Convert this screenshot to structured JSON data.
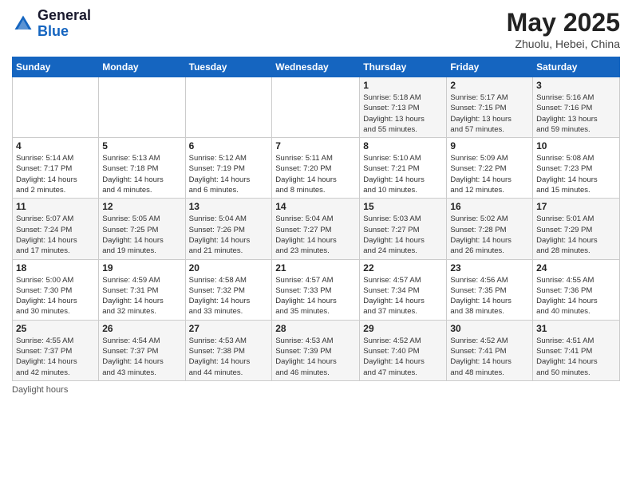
{
  "logo": {
    "general": "General",
    "blue": "Blue"
  },
  "title": {
    "month": "May 2025",
    "location": "Zhuolu, Hebei, China"
  },
  "days_of_week": [
    "Sunday",
    "Monday",
    "Tuesday",
    "Wednesday",
    "Thursday",
    "Friday",
    "Saturday"
  ],
  "footer": {
    "daylight_hours": "Daylight hours"
  },
  "weeks": [
    [
      {
        "day": "",
        "info": ""
      },
      {
        "day": "",
        "info": ""
      },
      {
        "day": "",
        "info": ""
      },
      {
        "day": "",
        "info": ""
      },
      {
        "day": "1",
        "info": "Sunrise: 5:18 AM\nSunset: 7:13 PM\nDaylight: 13 hours\nand 55 minutes."
      },
      {
        "day": "2",
        "info": "Sunrise: 5:17 AM\nSunset: 7:15 PM\nDaylight: 13 hours\nand 57 minutes."
      },
      {
        "day": "3",
        "info": "Sunrise: 5:16 AM\nSunset: 7:16 PM\nDaylight: 13 hours\nand 59 minutes."
      }
    ],
    [
      {
        "day": "4",
        "info": "Sunrise: 5:14 AM\nSunset: 7:17 PM\nDaylight: 14 hours\nand 2 minutes."
      },
      {
        "day": "5",
        "info": "Sunrise: 5:13 AM\nSunset: 7:18 PM\nDaylight: 14 hours\nand 4 minutes."
      },
      {
        "day": "6",
        "info": "Sunrise: 5:12 AM\nSunset: 7:19 PM\nDaylight: 14 hours\nand 6 minutes."
      },
      {
        "day": "7",
        "info": "Sunrise: 5:11 AM\nSunset: 7:20 PM\nDaylight: 14 hours\nand 8 minutes."
      },
      {
        "day": "8",
        "info": "Sunrise: 5:10 AM\nSunset: 7:21 PM\nDaylight: 14 hours\nand 10 minutes."
      },
      {
        "day": "9",
        "info": "Sunrise: 5:09 AM\nSunset: 7:22 PM\nDaylight: 14 hours\nand 12 minutes."
      },
      {
        "day": "10",
        "info": "Sunrise: 5:08 AM\nSunset: 7:23 PM\nDaylight: 14 hours\nand 15 minutes."
      }
    ],
    [
      {
        "day": "11",
        "info": "Sunrise: 5:07 AM\nSunset: 7:24 PM\nDaylight: 14 hours\nand 17 minutes."
      },
      {
        "day": "12",
        "info": "Sunrise: 5:05 AM\nSunset: 7:25 PM\nDaylight: 14 hours\nand 19 minutes."
      },
      {
        "day": "13",
        "info": "Sunrise: 5:04 AM\nSunset: 7:26 PM\nDaylight: 14 hours\nand 21 minutes."
      },
      {
        "day": "14",
        "info": "Sunrise: 5:04 AM\nSunset: 7:27 PM\nDaylight: 14 hours\nand 23 minutes."
      },
      {
        "day": "15",
        "info": "Sunrise: 5:03 AM\nSunset: 7:27 PM\nDaylight: 14 hours\nand 24 minutes."
      },
      {
        "day": "16",
        "info": "Sunrise: 5:02 AM\nSunset: 7:28 PM\nDaylight: 14 hours\nand 26 minutes."
      },
      {
        "day": "17",
        "info": "Sunrise: 5:01 AM\nSunset: 7:29 PM\nDaylight: 14 hours\nand 28 minutes."
      }
    ],
    [
      {
        "day": "18",
        "info": "Sunrise: 5:00 AM\nSunset: 7:30 PM\nDaylight: 14 hours\nand 30 minutes."
      },
      {
        "day": "19",
        "info": "Sunrise: 4:59 AM\nSunset: 7:31 PM\nDaylight: 14 hours\nand 32 minutes."
      },
      {
        "day": "20",
        "info": "Sunrise: 4:58 AM\nSunset: 7:32 PM\nDaylight: 14 hours\nand 33 minutes."
      },
      {
        "day": "21",
        "info": "Sunrise: 4:57 AM\nSunset: 7:33 PM\nDaylight: 14 hours\nand 35 minutes."
      },
      {
        "day": "22",
        "info": "Sunrise: 4:57 AM\nSunset: 7:34 PM\nDaylight: 14 hours\nand 37 minutes."
      },
      {
        "day": "23",
        "info": "Sunrise: 4:56 AM\nSunset: 7:35 PM\nDaylight: 14 hours\nand 38 minutes."
      },
      {
        "day": "24",
        "info": "Sunrise: 4:55 AM\nSunset: 7:36 PM\nDaylight: 14 hours\nand 40 minutes."
      }
    ],
    [
      {
        "day": "25",
        "info": "Sunrise: 4:55 AM\nSunset: 7:37 PM\nDaylight: 14 hours\nand 42 minutes."
      },
      {
        "day": "26",
        "info": "Sunrise: 4:54 AM\nSunset: 7:37 PM\nDaylight: 14 hours\nand 43 minutes."
      },
      {
        "day": "27",
        "info": "Sunrise: 4:53 AM\nSunset: 7:38 PM\nDaylight: 14 hours\nand 44 minutes."
      },
      {
        "day": "28",
        "info": "Sunrise: 4:53 AM\nSunset: 7:39 PM\nDaylight: 14 hours\nand 46 minutes."
      },
      {
        "day": "29",
        "info": "Sunrise: 4:52 AM\nSunset: 7:40 PM\nDaylight: 14 hours\nand 47 minutes."
      },
      {
        "day": "30",
        "info": "Sunrise: 4:52 AM\nSunset: 7:41 PM\nDaylight: 14 hours\nand 48 minutes."
      },
      {
        "day": "31",
        "info": "Sunrise: 4:51 AM\nSunset: 7:41 PM\nDaylight: 14 hours\nand 50 minutes."
      }
    ]
  ]
}
